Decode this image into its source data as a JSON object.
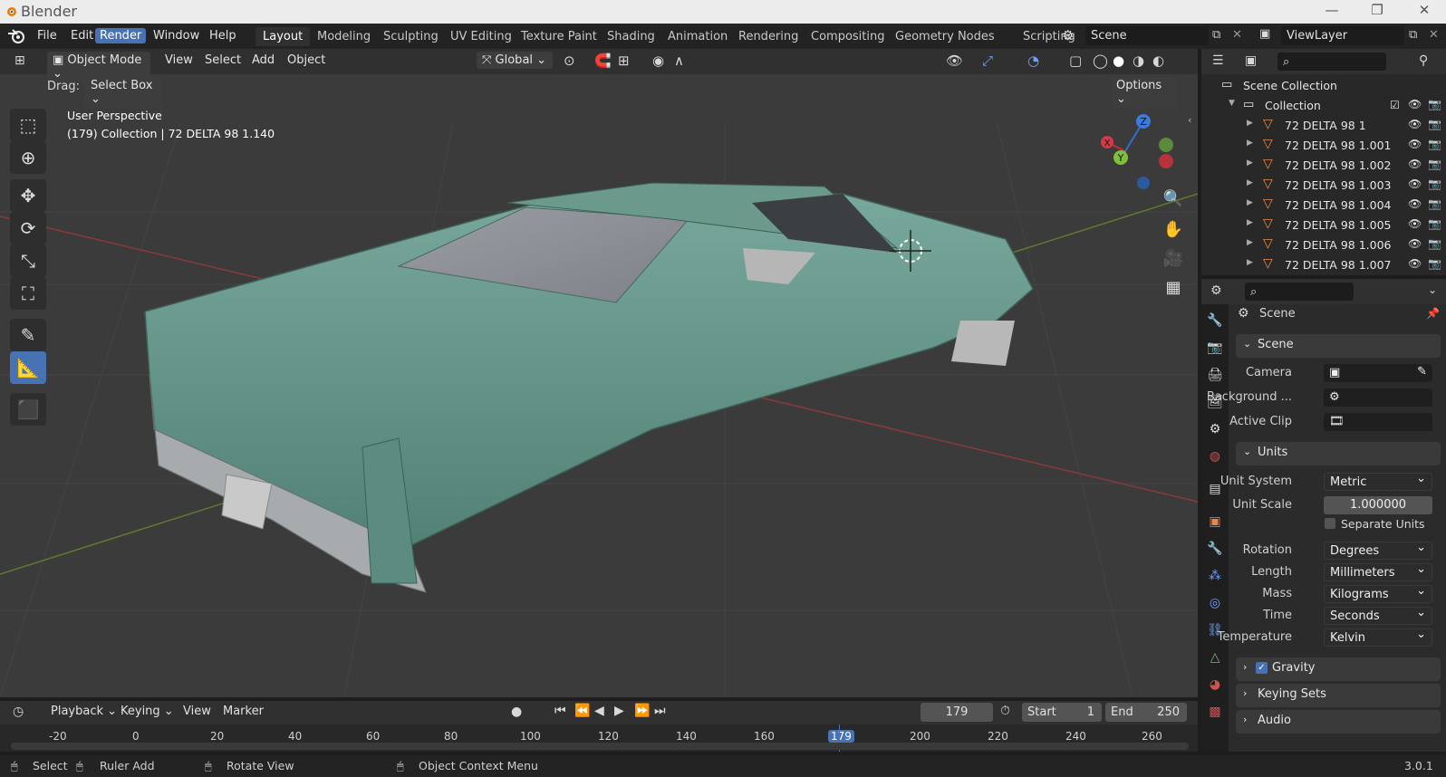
{
  "titlebar": {
    "app_name": "Blender",
    "minimize": "—",
    "maximize": "❐",
    "close": "✕"
  },
  "menu": {
    "file": "File",
    "edit": "Edit",
    "render": "Render",
    "window": "Window",
    "help": "Help"
  },
  "workspaces": [
    "Layout",
    "Modeling",
    "Sculpting",
    "UV Editing",
    "Texture Paint",
    "Shading",
    "Animation",
    "Rendering",
    "Compositing",
    "Geometry Nodes",
    "Scripting"
  ],
  "scene_field": "Scene",
  "viewlayer_field": "ViewLayer",
  "viewport_header": {
    "mode": "Object Mode",
    "view": "View",
    "select": "Select",
    "add": "Add",
    "object": "Object",
    "orientation": "Global",
    "drag_label": "Drag:",
    "drag_value": "Select Box",
    "options": "Options"
  },
  "viewport": {
    "perspective": "User Perspective",
    "collection_info": "(179) Collection | 72 DELTA 98 1.140",
    "gizmo": {
      "z": "Z",
      "y": "Y",
      "x": "X"
    }
  },
  "outliner": {
    "scene_collection": "Scene Collection",
    "collection": "Collection",
    "items": [
      "72 DELTA 98 1",
      "72 DELTA 98 1.001",
      "72 DELTA 98 1.002",
      "72 DELTA 98 1.003",
      "72 DELTA 98 1.004",
      "72 DELTA 98 1.005",
      "72 DELTA 98 1.006",
      "72 DELTA 98 1.007"
    ]
  },
  "properties": {
    "context": "Scene",
    "scene_panel": "Scene",
    "camera_label": "Camera",
    "background_label": "Background ...",
    "active_clip_label": "Active Clip",
    "units_panel": "Units",
    "unit_system_label": "Unit System",
    "unit_system": "Metric",
    "unit_scale_label": "Unit Scale",
    "unit_scale": "1.000000",
    "separate_units": "Separate Units",
    "rotation_label": "Rotation",
    "rotation": "Degrees",
    "length_label": "Length",
    "length": "Millimeters",
    "mass_label": "Mass",
    "mass": "Kilograms",
    "time_label": "Time",
    "time": "Seconds",
    "temperature_label": "Temperature",
    "temperature": "Kelvin",
    "gravity_panel": "Gravity",
    "keying_sets_panel": "Keying Sets",
    "audio_panel": "Audio"
  },
  "timeline": {
    "playback": "Playback",
    "keying": "Keying",
    "view": "View",
    "marker": "Marker",
    "current_frame": "179",
    "start_label": "Start",
    "start": "1",
    "end_label": "End",
    "end": "250",
    "ruler": [
      "-20",
      "0",
      "20",
      "40",
      "60",
      "80",
      "100",
      "120",
      "140",
      "160",
      "179",
      "200",
      "220",
      "240",
      "260"
    ]
  },
  "statusbar": {
    "select": "Select",
    "ruler_add": "Ruler Add",
    "rotate_view": "Rotate View",
    "context_menu": "Object Context Menu",
    "version": "3.0.1"
  },
  "colors": {
    "accent": "#4772b3",
    "car_body": "#5e9486",
    "object_icon": "#e8894a"
  }
}
